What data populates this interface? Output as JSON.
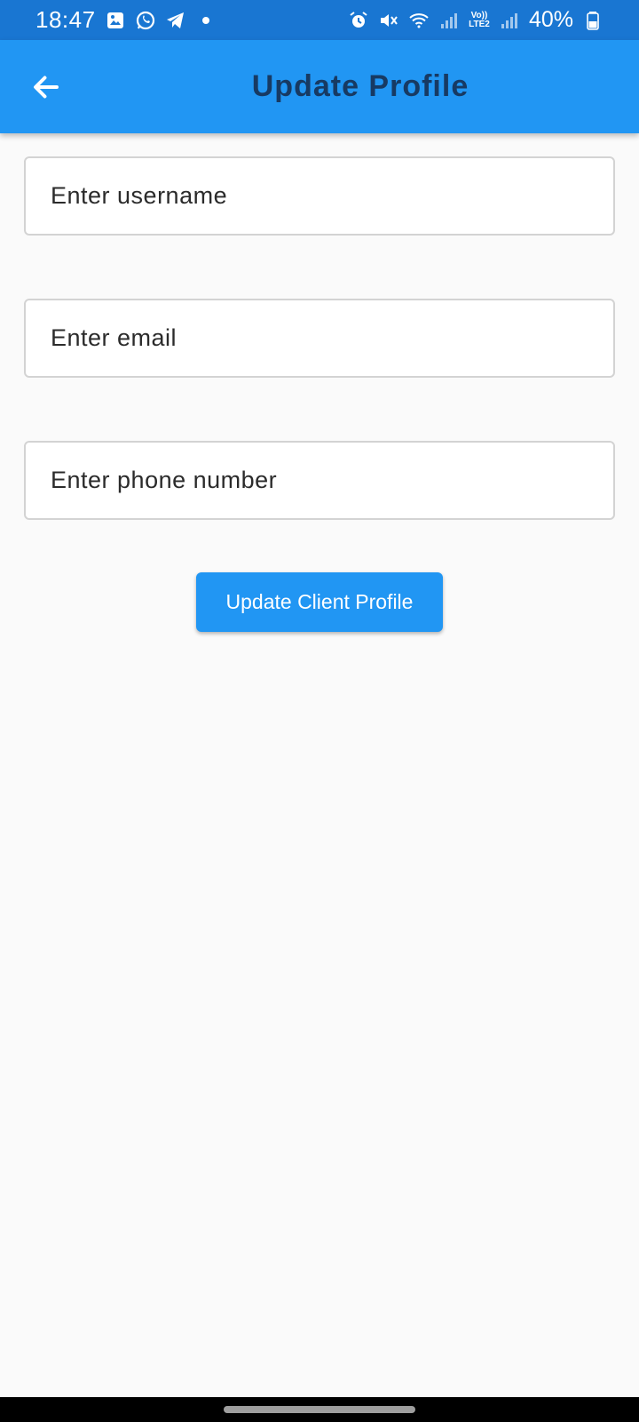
{
  "status_bar": {
    "time": "18:47",
    "left_icons": [
      "gallery-icon",
      "whatsapp-icon",
      "telegram-icon",
      "dot-icon"
    ],
    "right_icons": [
      "alarm-icon",
      "mute-icon",
      "wifi-icon",
      "signal-icon",
      "volte-icon",
      "signal-icon",
      "battery-icon"
    ],
    "lte_label_top": "Vo))",
    "lte_label_bottom": "LTE2",
    "battery": "40%"
  },
  "app_bar": {
    "title": "Update Profile",
    "back_icon": "arrow-back-icon",
    "color": "#2196f3",
    "title_color": "#173a63"
  },
  "form": {
    "username_placeholder": "Enter username",
    "username_value": "",
    "email_placeholder": "Enter email",
    "email_value": "",
    "phone_placeholder": "Enter phone number",
    "phone_value": "",
    "submit_label": "Update Client Profile"
  },
  "colors": {
    "status_bar": "#1976d2",
    "accent": "#2196f3",
    "background": "#fafafa"
  }
}
